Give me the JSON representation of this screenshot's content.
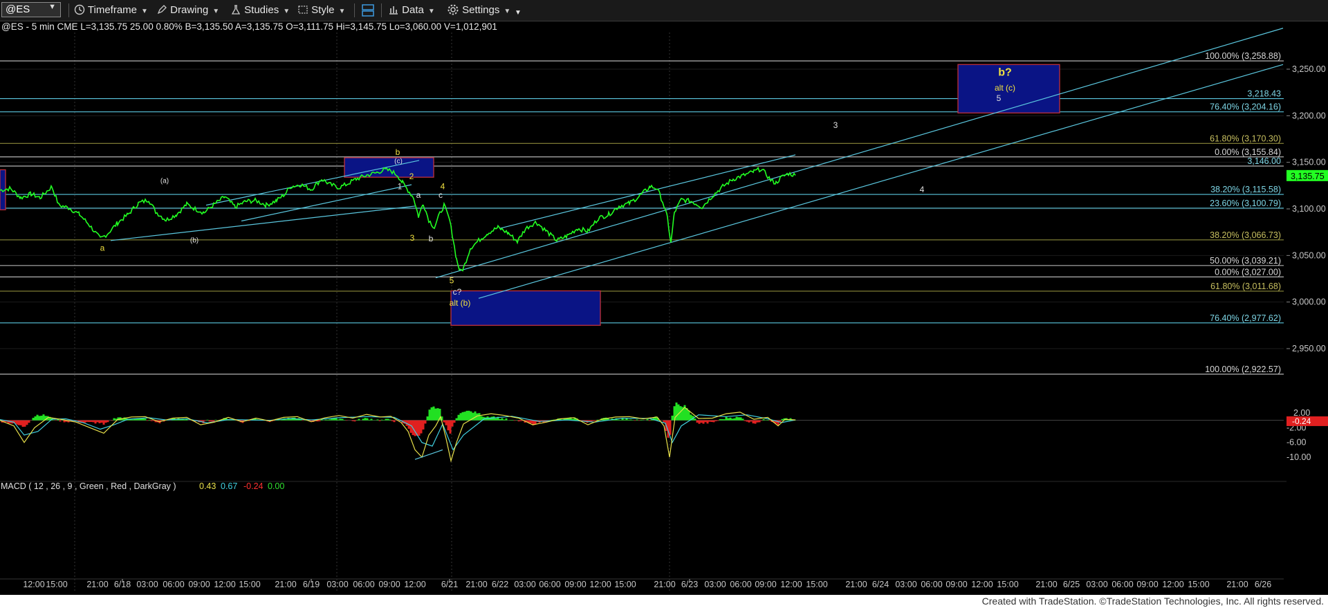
{
  "toolbar": {
    "symbol": "@ES",
    "timeframe": "Timeframe",
    "drawing": "Drawing",
    "studies": "Studies",
    "style": "Style",
    "data": "Data",
    "settings": "Settings"
  },
  "header": {
    "quote": "@ES - 5 min  CME  L=3,135.75  25.00  0.80%   B=3,135.50  A=3,135.75  O=3,111.75  Hi=3,145.75  Lo=3,060.00  V=1,012,901"
  },
  "macd_header": {
    "label": "MACD ( 12 , 26 , 9 , Green , Red , DarkGray )",
    "v1": "0.43",
    "v2": "0.67",
    "v3": "-0.24",
    "v4": "0.00",
    "v1_color": "#e8e04a",
    "v2_color": "#40d0e0",
    "v3_color": "#ff3030",
    "v4_color": "#30e030"
  },
  "footer": {
    "credit": "Created with TradeStation. ©TradeStation Technologies, Inc. All rights reserved."
  },
  "colors": {
    "price": "#22ff22",
    "channel": "#5bc8e0",
    "box_fill": "#0a1485",
    "box_border": "#c0303a",
    "fib_yellow": "#8c8a3a",
    "fib_cyan": "#3a8a92",
    "fib_white": "#c8c8c8",
    "axis_text": "#c8c8c8",
    "wave_label": "#f0e040",
    "last_price_bg": "#22ff22"
  },
  "chart_data": {
    "type": "line",
    "symbol": "@ES",
    "interval": "5 min",
    "price_axis": {
      "ticks": [
        "3,250.00",
        "3,200.00",
        "3,150.00",
        "3,100.00",
        "3,050.00",
        "3,000.00",
        "2,950.00"
      ],
      "tick_values": [
        3250,
        3200,
        3150,
        3100,
        3050,
        3000,
        2950
      ],
      "ylim": [
        2922,
        3295
      ],
      "last_price": "3,135.75",
      "last_price_value": 3135.75,
      "marker_3146": "3,146.00",
      "marker_3146_value": 3146,
      "marker_3218": "3,218.43",
      "marker_3218_value": 3218.43
    },
    "time_axis": {
      "labels": [
        "12:00",
        "15:00",
        "21:00",
        "6/18",
        "03:00",
        "06:00",
        "09:00",
        "12:00",
        "15:00",
        "21:00",
        "6/19",
        "03:00",
        "06:00",
        "09:00",
        "12:00",
        "6/21",
        "21:00",
        "6/22",
        "03:00",
        "06:00",
        "09:00",
        "12:00",
        "15:00",
        "21:00",
        "6/23",
        "03:00",
        "06:00",
        "09:00",
        "12:00",
        "15:00",
        "21:00",
        "6/24",
        "03:00",
        "06:00",
        "09:00",
        "12:00",
        "15:00",
        "21:00",
        "6/25",
        "03:00",
        "06:00",
        "09:00",
        "12:00",
        "15:00",
        "21:00",
        "6/26"
      ],
      "session_breaks": [
        "6/18",
        "6/19",
        "6/21",
        "6/23"
      ]
    },
    "price_series": [
      [
        0,
        3120
      ],
      [
        15,
        3122
      ],
      [
        30,
        3112
      ],
      [
        45,
        3116
      ],
      [
        58,
        3112
      ],
      [
        75,
        3124
      ],
      [
        85,
        3104
      ],
      [
        100,
        3101
      ],
      [
        115,
        3094
      ],
      [
        130,
        3082
      ],
      [
        145,
        3068
      ],
      [
        155,
        3073
      ],
      [
        170,
        3085
      ],
      [
        185,
        3094
      ],
      [
        200,
        3106
      ],
      [
        215,
        3110
      ],
      [
        225,
        3097
      ],
      [
        240,
        3088
      ],
      [
        255,
        3094
      ],
      [
        270,
        3105
      ],
      [
        282,
        3100
      ],
      [
        295,
        3096
      ],
      [
        310,
        3105
      ],
      [
        325,
        3113
      ],
      [
        340,
        3102
      ],
      [
        355,
        3108
      ],
      [
        370,
        3109
      ],
      [
        385,
        3104
      ],
      [
        400,
        3109
      ],
      [
        412,
        3116
      ],
      [
        420,
        3124
      ],
      [
        435,
        3126
      ],
      [
        450,
        3121
      ],
      [
        465,
        3132
      ],
      [
        478,
        3126
      ],
      [
        490,
        3123
      ],
      [
        500,
        3126
      ],
      [
        515,
        3132
      ],
      [
        530,
        3136
      ],
      [
        545,
        3139
      ],
      [
        555,
        3142
      ],
      [
        565,
        3141
      ],
      [
        575,
        3136
      ],
      [
        582,
        3128
      ],
      [
        590,
        3120
      ],
      [
        598,
        3112
      ],
      [
        605,
        3092
      ],
      [
        612,
        3106
      ],
      [
        620,
        3088
      ],
      [
        628,
        3080
      ],
      [
        636,
        3095
      ],
      [
        642,
        3104
      ],
      [
        650,
        3088
      ],
      [
        655,
        3068
      ],
      [
        660,
        3046
      ],
      [
        665,
        3033
      ],
      [
        670,
        3036
      ],
      [
        680,
        3058
      ],
      [
        692,
        3066
      ],
      [
        705,
        3074
      ],
      [
        720,
        3080
      ],
      [
        735,
        3074
      ],
      [
        748,
        3065
      ],
      [
        760,
        3079
      ],
      [
        775,
        3086
      ],
      [
        790,
        3076
      ],
      [
        805,
        3066
      ],
      [
        820,
        3071
      ],
      [
        835,
        3079
      ],
      [
        850,
        3076
      ],
      [
        865,
        3090
      ],
      [
        880,
        3094
      ],
      [
        895,
        3103
      ],
      [
        910,
        3106
      ],
      [
        925,
        3114
      ],
      [
        940,
        3124
      ],
      [
        950,
        3122
      ],
      [
        958,
        3108
      ],
      [
        965,
        3090
      ],
      [
        970,
        3063
      ],
      [
        975,
        3096
      ],
      [
        985,
        3110
      ],
      [
        1000,
        3108
      ],
      [
        1015,
        3102
      ],
      [
        1030,
        3114
      ],
      [
        1045,
        3124
      ],
      [
        1060,
        3132
      ],
      [
        1075,
        3136
      ],
      [
        1090,
        3140
      ],
      [
        1100,
        3143
      ],
      [
        1108,
        3137
      ],
      [
        1115,
        3130
      ],
      [
        1122,
        3128
      ],
      [
        1130,
        3134
      ],
      [
        1140,
        3138
      ],
      [
        1150,
        3136
      ]
    ],
    "fib_levels": [
      {
        "label": "100.00% (3,258.88)",
        "value": 3258.88,
        "color": "#c8c8c8"
      },
      {
        "label": "76.40% (3,204.16)",
        "value": 3204.16,
        "color": "#5bc8e0"
      },
      {
        "label": "61.80% (3,170.30)",
        "value": 3170.3,
        "color": "#8c8a3a"
      },
      {
        "label": "0.00% (3,155.84)",
        "value": 3155.84,
        "color": "#c8c8c8"
      },
      {
        "label": "38.20% (3,115.58)",
        "value": 3115.58,
        "color": "#5bc8e0"
      },
      {
        "label": "23.60% (3,100.79)",
        "value": 3100.79,
        "color": "#5bc8e0"
      },
      {
        "label": "38.20% (3,066.73)",
        "value": 3066.73,
        "color": "#8c8a3a"
      },
      {
        "label": "50.00% (3,039.21)",
        "value": 3039.21,
        "color": "#c8c8c8"
      },
      {
        "label": "0.00% (3,027.00)",
        "value": 3027.0,
        "color": "#c8c8c8"
      },
      {
        "label": "61.80% (3,011.68)",
        "value": 3011.68,
        "color": "#8c8a3a"
      },
      {
        "label": "76.40% (2,977.62)",
        "value": 2977.62,
        "color": "#5bc8e0"
      },
      {
        "label": "100.00% (2,922.57)",
        "value": 2922.57,
        "color": "#c8c8c8"
      }
    ],
    "extra_lines": [
      {
        "value": 3146,
        "color": "#c8c8c8"
      },
      {
        "value": 3218.43,
        "color": "#5bc8e0"
      }
    ],
    "boxes": [
      {
        "x0": 1385,
        "x1": 1532,
        "top": 3255,
        "bottom": 3203
      },
      {
        "x0": 498,
        "x1": 627,
        "top": 3155,
        "bottom": 3134
      },
      {
        "x0": 652,
        "x1": 868,
        "top": 3012,
        "bottom": 2975
      },
      {
        "x0": 0,
        "x1": 8,
        "top": 3142,
        "bottom": 3099
      }
    ],
    "wave_labels": [
      {
        "text": "b?",
        "x": 1453,
        "v": 3243,
        "color": "#f0e040",
        "size": 16,
        "bold": true
      },
      {
        "text": "alt (c)",
        "x": 1453,
        "v": 3227,
        "color": "#f0e040",
        "size": 12
      },
      {
        "text": "5",
        "x": 1444,
        "v": 3216,
        "color": "#e0e0e0",
        "size": 12
      },
      {
        "text": "3",
        "x": 1208,
        "v": 3187,
        "color": "#e0e0e0",
        "size": 12
      },
      {
        "text": "4",
        "x": 1333,
        "v": 3118,
        "color": "#e0e0e0",
        "size": 12
      },
      {
        "text": "b",
        "x": 575,
        "v": 3158,
        "color": "#f0e040",
        "size": 12
      },
      {
        "text": "(c)",
        "x": 576,
        "v": 3149,
        "color": "#e0e0e0",
        "size": 10
      },
      {
        "text": "2",
        "x": 595,
        "v": 3132,
        "color": "#f0e040",
        "size": 12
      },
      {
        "text": "1",
        "x": 578,
        "v": 3121,
        "color": "#e0e0e0",
        "size": 12
      },
      {
        "text": "a",
        "x": 605,
        "v": 3112,
        "color": "#e0e0e0",
        "size": 12
      },
      {
        "text": "4",
        "x": 640,
        "v": 3121,
        "color": "#f0e040",
        "size": 12
      },
      {
        "text": "c",
        "x": 637,
        "v": 3112,
        "color": "#e0e0e0",
        "size": 12
      },
      {
        "text": "3",
        "x": 596,
        "v": 3066,
        "color": "#f0e040",
        "size": 12
      },
      {
        "text": "b",
        "x": 623,
        "v": 3065,
        "color": "#e0e0e0",
        "size": 12
      },
      {
        "text": "5",
        "x": 653,
        "v": 3020,
        "color": "#f0e040",
        "size": 12
      },
      {
        "text": "c?",
        "x": 661,
        "v": 3008,
        "color": "#e0e0e0",
        "size": 12
      },
      {
        "text": "alt (b)",
        "x": 665,
        "v": 2996,
        "color": "#f0e040",
        "size": 12
      },
      {
        "text": "(a)",
        "x": 238,
        "v": 3128,
        "color": "#e0e0e0",
        "size": 10
      },
      {
        "text": "(b)",
        "x": 281,
        "v": 3064,
        "color": "#e0e0e0",
        "size": 10
      },
      {
        "text": "a",
        "x": 148,
        "v": 3055,
        "color": "#f0e040",
        "size": 12
      }
    ],
    "trendlines": [
      [
        [
          160,
          3066
        ],
        [
          600,
          3103
        ]
      ],
      [
        [
          298,
          3104
        ],
        [
          606,
          3152
        ]
      ],
      [
        [
          349,
          3087
        ],
        [
          595,
          3126
        ]
      ],
      [
        [
          630,
          3026
        ],
        [
          1855,
          3294
        ]
      ],
      [
        [
          692,
          3004
        ],
        [
          1855,
          3255
        ]
      ],
      [
        [
          722,
          3079
        ],
        [
          1150,
          3158
        ]
      ]
    ],
    "macd": {
      "ticks": [
        "2.00",
        "-2.00",
        "-6.00",
        "-10.00"
      ],
      "tick_values": [
        2,
        -2,
        -6,
        -10
      ],
      "current": "-0.24",
      "ylim": [
        -13,
        4
      ],
      "macd_line": [
        [
          0,
          0
        ],
        [
          20,
          -1.5
        ],
        [
          35,
          -6
        ],
        [
          50,
          -2
        ],
        [
          70,
          0.8
        ],
        [
          90,
          0.2
        ],
        [
          110,
          -0.5
        ],
        [
          130,
          -2
        ],
        [
          150,
          -3.5
        ],
        [
          170,
          0.2
        ],
        [
          190,
          0.9
        ],
        [
          210,
          1
        ],
        [
          230,
          -0.4
        ],
        [
          250,
          0.6
        ],
        [
          270,
          0.8
        ],
        [
          290,
          -1.2
        ],
        [
          310,
          -0.5
        ],
        [
          330,
          0.8
        ],
        [
          350,
          -0.4
        ],
        [
          370,
          0.6
        ],
        [
          390,
          -0.2
        ],
        [
          410,
          0.8
        ],
        [
          430,
          1
        ],
        [
          450,
          -0.4
        ],
        [
          470,
          0.7
        ],
        [
          490,
          1.3
        ],
        [
          510,
          0.6
        ],
        [
          530,
          1.6
        ],
        [
          550,
          0.9
        ],
        [
          565,
          1.1
        ],
        [
          580,
          -0.6
        ],
        [
          590,
          -3
        ],
        [
          600,
          -8
        ],
        [
          610,
          -10
        ],
        [
          620,
          -4
        ],
        [
          630,
          -1.5
        ],
        [
          637,
          1
        ],
        [
          645,
          -5
        ],
        [
          652,
          -11
        ],
        [
          660,
          -6
        ],
        [
          670,
          -1
        ],
        [
          690,
          1.2
        ],
        [
          710,
          1.8
        ],
        [
          730,
          1.3
        ],
        [
          750,
          0.6
        ],
        [
          770,
          -1.2
        ],
        [
          790,
          -0.5
        ],
        [
          810,
          0.4
        ],
        [
          830,
          0.7
        ],
        [
          850,
          -1.2
        ],
        [
          870,
          0.3
        ],
        [
          890,
          0.9
        ],
        [
          910,
          1
        ],
        [
          930,
          0.4
        ],
        [
          950,
          0.9
        ],
        [
          960,
          -1.5
        ],
        [
          968,
          -10
        ],
        [
          976,
          0.8
        ],
        [
          990,
          3.5
        ],
        [
          1010,
          0.5
        ],
        [
          1030,
          0.6
        ],
        [
          1050,
          1.8
        ],
        [
          1070,
          2.2
        ],
        [
          1090,
          0.3
        ],
        [
          1110,
          0.8
        ],
        [
          1125,
          -1.5
        ],
        [
          1135,
          0.3
        ],
        [
          1150,
          0.1
        ]
      ],
      "signal_line": [
        [
          0,
          0.2
        ],
        [
          20,
          -0.5
        ],
        [
          35,
          -4
        ],
        [
          55,
          -3
        ],
        [
          75,
          0.3
        ],
        [
          95,
          0.4
        ],
        [
          120,
          -0.6
        ],
        [
          145,
          -2.4
        ],
        [
          165,
          -1.2
        ],
        [
          185,
          0.3
        ],
        [
          215,
          0.7
        ],
        [
          240,
          0.1
        ],
        [
          270,
          0.4
        ],
        [
          300,
          -0.7
        ],
        [
          330,
          0.2
        ],
        [
          360,
          0.1
        ],
        [
          390,
          0
        ],
        [
          420,
          0.5
        ],
        [
          450,
          0.1
        ],
        [
          490,
          0.7
        ],
        [
          530,
          1
        ],
        [
          570,
          0.8
        ],
        [
          595,
          -1.5
        ],
        [
          610,
          -6
        ],
        [
          625,
          -7
        ],
        [
          640,
          -1
        ],
        [
          655,
          -8
        ],
        [
          670,
          -4
        ],
        [
          700,
          0.4
        ],
        [
          740,
          1.1
        ],
        [
          780,
          -0.3
        ],
        [
          820,
          0.1
        ],
        [
          860,
          -0.5
        ],
        [
          900,
          0.6
        ],
        [
          940,
          0.5
        ],
        [
          962,
          -0.8
        ],
        [
          972,
          -6
        ],
        [
          985,
          -1.5
        ],
        [
          1010,
          1.5
        ],
        [
          1050,
          1
        ],
        [
          1080,
          1.5
        ],
        [
          1110,
          0.4
        ],
        [
          1130,
          -0.6
        ],
        [
          1150,
          0.1
        ]
      ]
    }
  }
}
